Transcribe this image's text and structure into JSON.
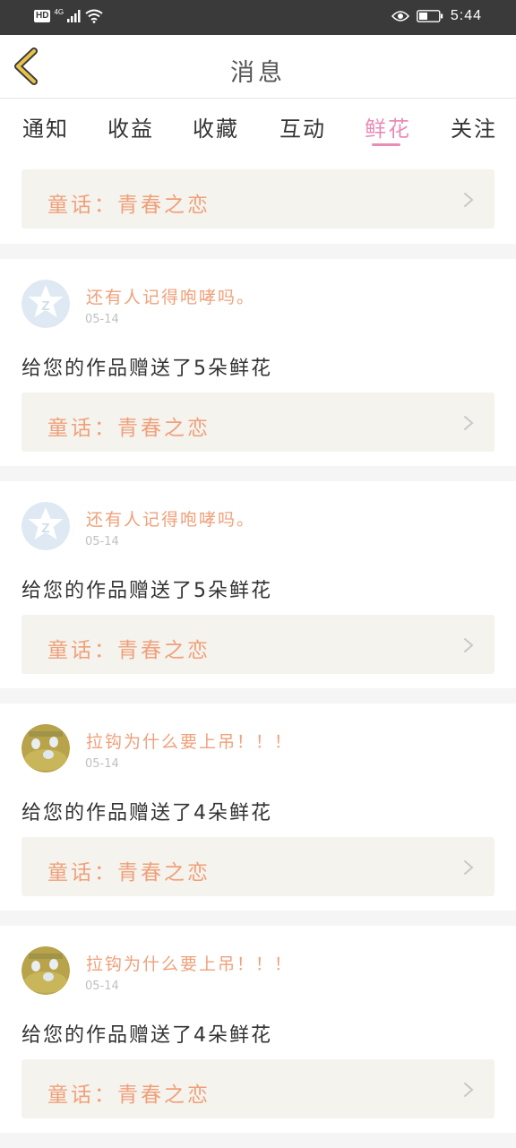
{
  "status_bar": {
    "hd_badge": "HD",
    "network": "4G",
    "time": "5:44",
    "icons": [
      "signal-icon",
      "wifi-icon",
      "eye-icon",
      "battery-icon"
    ]
  },
  "header": {
    "title": "消息",
    "back_icon": "chevron-left-icon"
  },
  "tabs": [
    {
      "label": "通知",
      "active": false
    },
    {
      "label": "收益",
      "active": false
    },
    {
      "label": "收藏",
      "active": false
    },
    {
      "label": "互动",
      "active": false
    },
    {
      "label": "鲜花",
      "active": true
    },
    {
      "label": "关注",
      "active": false
    }
  ],
  "top_card": {
    "work": "童话：青春之恋"
  },
  "messages": [
    {
      "user": "还有人记得咆哮吗。",
      "date": "05-14",
      "text": "给您的作品赠送了5朵鲜花",
      "work": "童话：青春之恋",
      "avatar": "default-avatar-icon"
    },
    {
      "user": "还有人记得咆哮吗。",
      "date": "05-14",
      "text": "给您的作品赠送了5朵鲜花",
      "work": "童话：青春之恋",
      "avatar": "default-avatar-icon"
    },
    {
      "user": "拉钩为什么要上吊！！！",
      "date": "05-14",
      "text": "给您的作品赠送了4朵鲜花",
      "work": "童话：青春之恋",
      "avatar": "photo-avatar"
    },
    {
      "user": "拉钩为什么要上吊！！！",
      "date": "05-14",
      "text": "给您的作品赠送了4朵鲜花",
      "work": "童话：青春之恋",
      "avatar": "photo-avatar"
    }
  ],
  "colors": {
    "accent_pink": "#e98cb6",
    "work_orange": "#f0a07a",
    "card_bg": "#f4f3ee",
    "status_bar": "#3a3a3a",
    "back_chevron": "#e8c24a"
  }
}
